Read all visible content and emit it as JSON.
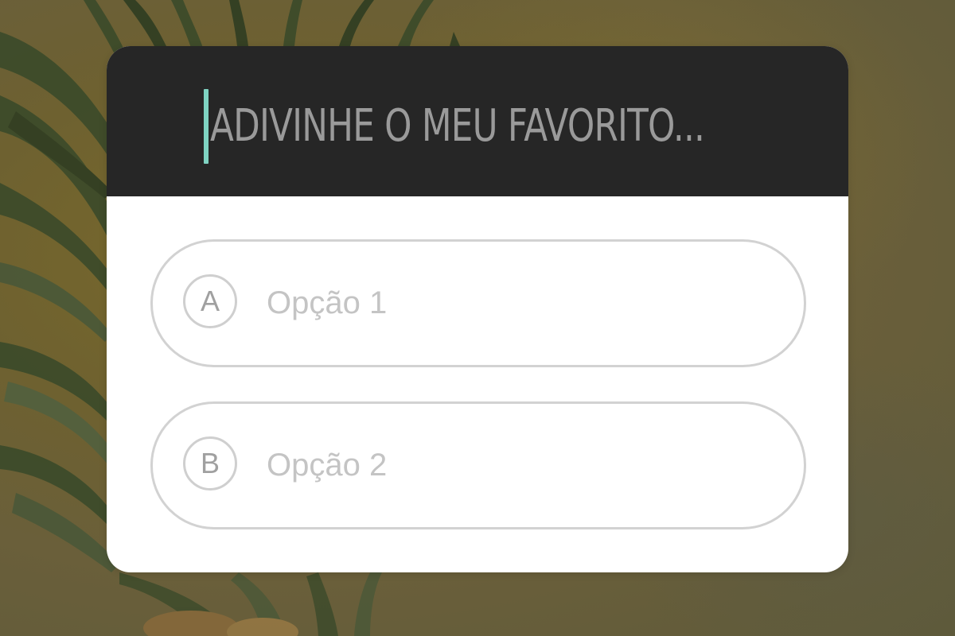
{
  "colors": {
    "header_background": "#262626",
    "cursor": "#7fd3c2",
    "question_text": "#9a9a9a",
    "option_border": "#d2d2d2",
    "option_text": "#c4c4c4",
    "background_gold": "#6e6130"
  },
  "quiz": {
    "question_placeholder": "ADIVINHE O MEU FAVORITO...",
    "options": [
      {
        "letter": "A",
        "label": "Opção 1"
      },
      {
        "letter": "B",
        "label": "Opção 2"
      }
    ]
  }
}
